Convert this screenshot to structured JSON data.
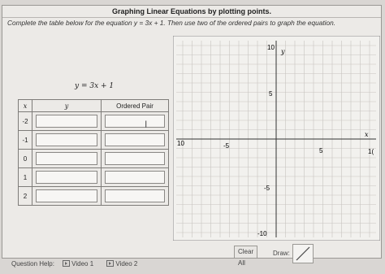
{
  "title": "Graphing Linear Equations by plotting points.",
  "instructions": "Complete the table below for the equation y = 3x + 1. Then use two of the ordered pairs to graph the equation.",
  "equation_label": "y = 3x + 1",
  "table": {
    "headers": [
      "x",
      "y",
      "Ordered Pair"
    ],
    "x_values": [
      "-2",
      "-1",
      "0",
      "1",
      "2"
    ]
  },
  "graph": {
    "x_axis_label": "x",
    "y_axis_label": "y",
    "tick_labels": {
      "y_top": "10",
      "y_5": "5",
      "y_neg5": "-5",
      "y_bottom": "-10",
      "x_left": "10",
      "x_neg5": "-5",
      "x_5": "5",
      "x_right": "1("
    }
  },
  "controls": {
    "clear_all": "Clear All",
    "draw_label": "Draw:"
  },
  "help": {
    "label": "Question Help:",
    "video1": "Video 1",
    "video2": "Video 2"
  }
}
